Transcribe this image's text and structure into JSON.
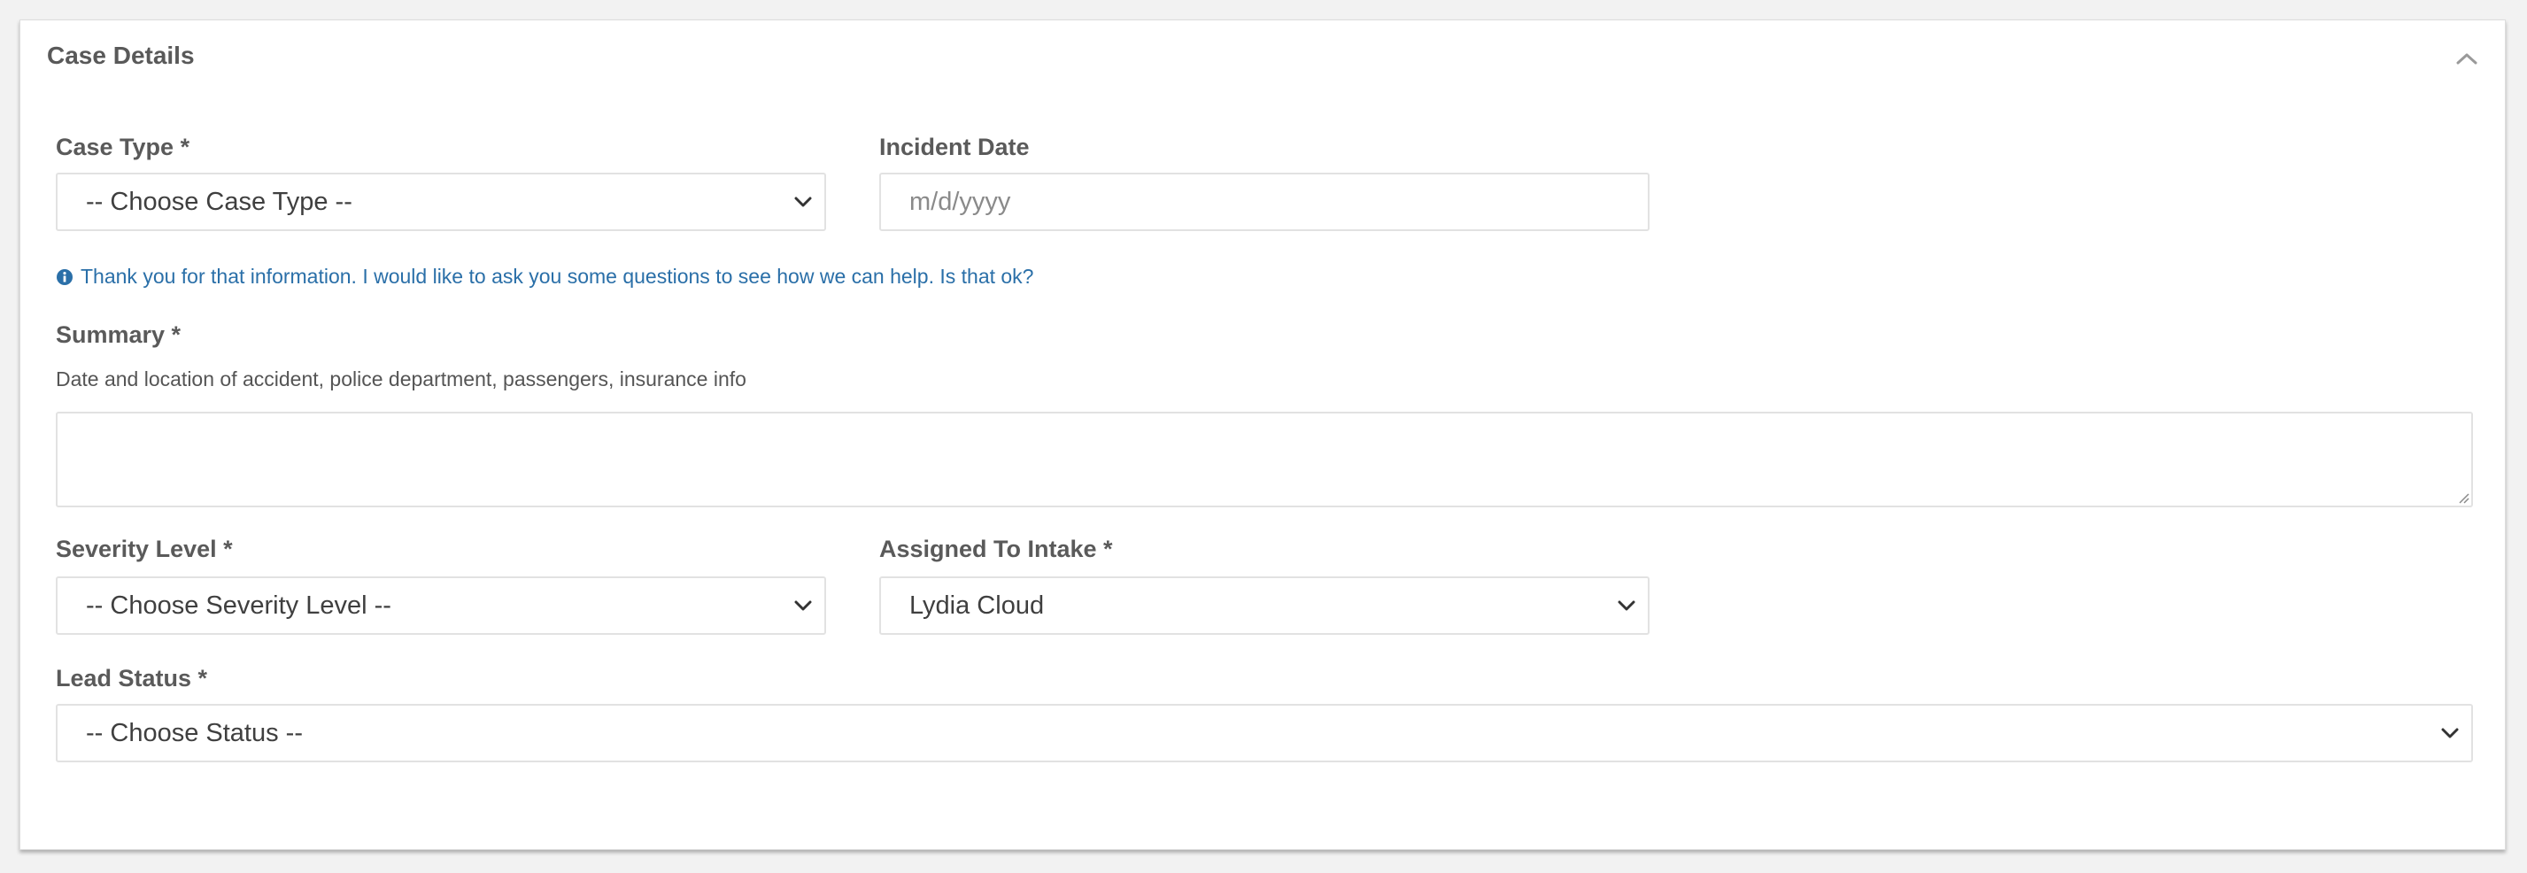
{
  "panel": {
    "title": "Case Details",
    "collapse_icon": "chevron-up-icon"
  },
  "case_type": {
    "label": "Case Type *",
    "selected": "-- Choose Case Type --"
  },
  "incident_date": {
    "label": "Incident Date",
    "placeholder": "m/d/yyyy"
  },
  "info_message": {
    "icon": "info-circle-icon",
    "text": "Thank you for that information. I would like to ask you some questions to see how we can help. Is that ok?",
    "color": "#2a6fa8"
  },
  "summary": {
    "label": "Summary *",
    "help": "Date and location of accident, police department, passengers, insurance info",
    "value": ""
  },
  "severity_level": {
    "label": "Severity Level *",
    "selected": "-- Choose Severity Level --"
  },
  "assigned_to_intake": {
    "label": "Assigned To Intake *",
    "selected": "Lydia Cloud"
  },
  "lead_status": {
    "label": "Lead Status *",
    "selected": "-- Choose Status --"
  }
}
